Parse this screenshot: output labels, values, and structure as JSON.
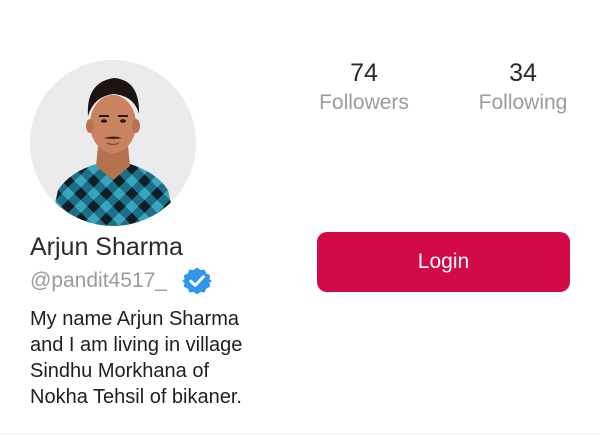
{
  "profile": {
    "display_name": "Arjun Sharma",
    "username": "@pandit4517_",
    "verified": true,
    "bio_lines": [
      "My name Arjun Sharma",
      "and I am living in village",
      "Sindhu Morkhana of",
      "Nokha Tehsil of bikaner."
    ]
  },
  "stats": {
    "followers": {
      "count": "74",
      "label": "Followers"
    },
    "following": {
      "count": "34",
      "label": "Following"
    }
  },
  "actions": {
    "login_label": "Login"
  },
  "icons": {
    "verified": "verified-badge-icon"
  },
  "colors": {
    "login_button": "#d20a47",
    "verified_badge": "#2f96ee",
    "muted_text": "#9b9b9b"
  }
}
